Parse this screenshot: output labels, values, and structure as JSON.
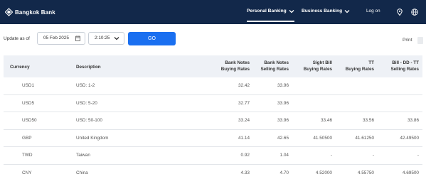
{
  "header": {
    "logo_text": "Bangkok Bank",
    "nav": {
      "personal": "Personal Banking",
      "business": "Business Banking",
      "login": "Log on"
    }
  },
  "filter": {
    "label": "Update as of",
    "date": "05 Feb 2025",
    "time": "2:10:25",
    "go_label": "GO",
    "print_label": "Print"
  },
  "table": {
    "headers": {
      "currency": "Currency",
      "description": "Description",
      "bank_notes_buying": [
        "Bank Notes",
        "Buying Rates"
      ],
      "bank_notes_selling": [
        "Bank Notes",
        "Selling Rates"
      ],
      "sight_bill_buying": [
        "Sight Bill",
        "Buying Rates"
      ],
      "tt_buying": [
        "TT",
        "Buying Rates"
      ],
      "bill_dd_tt_selling": [
        "Bill - DD - TT",
        "Selling Rates"
      ]
    },
    "rows": [
      {
        "currency": "USD1",
        "description": "USD: 1-2",
        "flag": "us",
        "bn_buy": "32.42",
        "bn_sell": "33.96",
        "sb_buy": "",
        "tt_buy": "",
        "dd_sell": ""
      },
      {
        "currency": "USD5",
        "description": "USD: 5-20",
        "flag": "us",
        "bn_buy": "32.77",
        "bn_sell": "33.96",
        "sb_buy": "",
        "tt_buy": "",
        "dd_sell": ""
      },
      {
        "currency": "USD50",
        "description": "USD: 50-100",
        "flag": "us",
        "bn_buy": "33.24",
        "bn_sell": "33.96",
        "sb_buy": "33.46",
        "tt_buy": "33.56",
        "dd_sell": "33.86"
      },
      {
        "currency": "GBP",
        "description": "United Kingdom",
        "flag": "gb",
        "bn_buy": "41.14",
        "bn_sell": "42.65",
        "sb_buy": "41.50500",
        "tt_buy": "41.61250",
        "dd_sell": "42.49500"
      },
      {
        "currency": "TWD",
        "description": "Taiwan",
        "flag": "tw",
        "bn_buy": "0.92",
        "bn_sell": "1.04",
        "sb_buy": "-",
        "tt_buy": "-",
        "dd_sell": "-"
      },
      {
        "currency": "CNY",
        "description": "China",
        "flag": "cn",
        "bn_buy": "4.33",
        "bn_sell": "4.70",
        "sb_buy": "4.52000",
        "tt_buy": "4.55750",
        "dd_sell": "4.69500"
      }
    ]
  },
  "colors": {
    "header_bg": "#12284a",
    "go_button": "#1a6ff0",
    "table_header_bg": "#eef1f6"
  }
}
